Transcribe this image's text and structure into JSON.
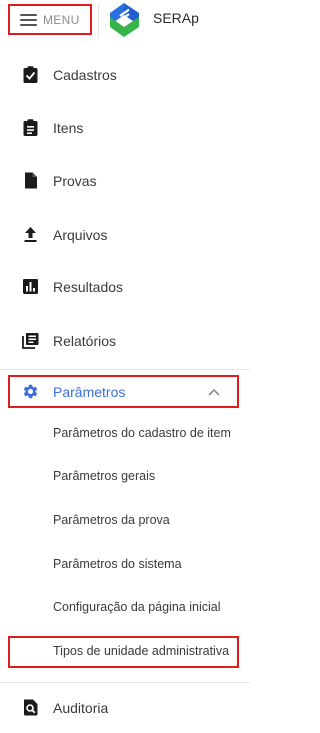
{
  "header": {
    "menu_label": "MENU",
    "brand": "SERAp"
  },
  "colors": {
    "accent": "#3d6ee0",
    "logo_blue": "#1f5fcf",
    "logo_green": "#35b44a",
    "highlight": "#e01d1d"
  },
  "nav": {
    "cadastros": {
      "label": "Cadastros",
      "icon": "clipboard-check-icon"
    },
    "itens": {
      "label": "Itens",
      "icon": "clipboard-list-icon"
    },
    "provas": {
      "label": "Provas",
      "icon": "document-icon"
    },
    "arquivos": {
      "label": "Arquivos",
      "icon": "upload-icon"
    },
    "resultados": {
      "label": "Resultados",
      "icon": "bar-chart-icon"
    },
    "relatorios": {
      "label": "Relatórios",
      "icon": "library-books-icon"
    },
    "parametros": {
      "label": "Parâmetros",
      "icon": "gear-icon",
      "expanded": true,
      "children": [
        {
          "label": "Parâmetros do cadastro de item"
        },
        {
          "label": "Parâmetros gerais"
        },
        {
          "label": "Parâmetros da prova"
        },
        {
          "label": "Parâmetros do sistema"
        },
        {
          "label": "Configuração da página inicial"
        },
        {
          "label": "Tipos de unidade administrativa"
        }
      ]
    },
    "auditoria": {
      "label": "Auditoria",
      "icon": "magnify-document-icon"
    }
  }
}
